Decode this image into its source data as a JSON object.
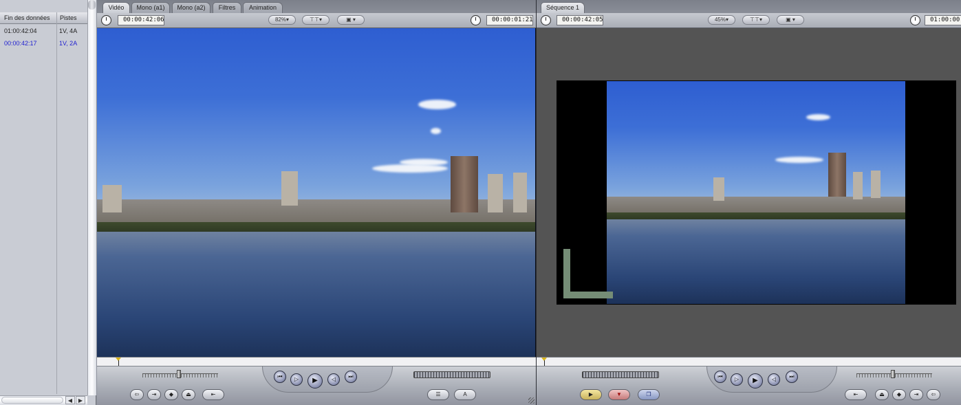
{
  "browser": {
    "columns": [
      "Fin des données",
      "Pistes"
    ],
    "rows": [
      {
        "end": "01:00:42:04",
        "tracks": "1V, 4A"
      },
      {
        "end": "00:00:42:17",
        "tracks": "1V, 2A"
      }
    ],
    "scroll_left": "◀",
    "scroll_right": "▶"
  },
  "viewer": {
    "tabs": [
      "Vidéo",
      "Mono (a1)",
      "Mono (a2)",
      "Filtres",
      "Animation"
    ],
    "active_tab": "Vidéo",
    "timecode_duration": "00:00:42:06",
    "timecode_current": "00:00:01:21",
    "zoom": "82%",
    "view_menu_icon": "▾",
    "controls": {
      "prev_edit": "⏮",
      "play_in_out": "▷",
      "play": "▶",
      "play_around": "◁",
      "next_edit": "⏭"
    },
    "buttons": {
      "insert": "⇦",
      "mark_in": "⇥",
      "marker": "◆",
      "match_frame": "⏏",
      "mark_out": "⇤",
      "recent": "☰",
      "generator": "A"
    }
  },
  "canvas": {
    "tabs": [
      "Séquence 1"
    ],
    "active_tab": "Séquence 1",
    "timecode_duration": "00:00:42:05",
    "timecode_current": "01:00:00",
    "zoom": "45%",
    "controls": {
      "prev_edit": "⏮",
      "play_in_out": "▷",
      "play": "▶",
      "play_around": "◁",
      "next_edit": "⏭"
    },
    "buttons": {
      "edit_insert": "▶",
      "edit_overwrite": "▼",
      "edit_replace": "❐",
      "mark_clip": "⇤",
      "marker": "◆",
      "match": "⏏",
      "mark_out": "⇥",
      "lift": "⇦"
    }
  },
  "colors": {
    "timecode_selected": "#2020d0",
    "playhead": "#d8b41a",
    "canvas_background": "#545454",
    "title_safe_overlay": "#758d76"
  },
  "icons": [
    "clock-icon",
    "dropdown-icon",
    "transport-prev-icon",
    "transport-play-icon",
    "transport-next-icon",
    "marker-icon"
  ]
}
